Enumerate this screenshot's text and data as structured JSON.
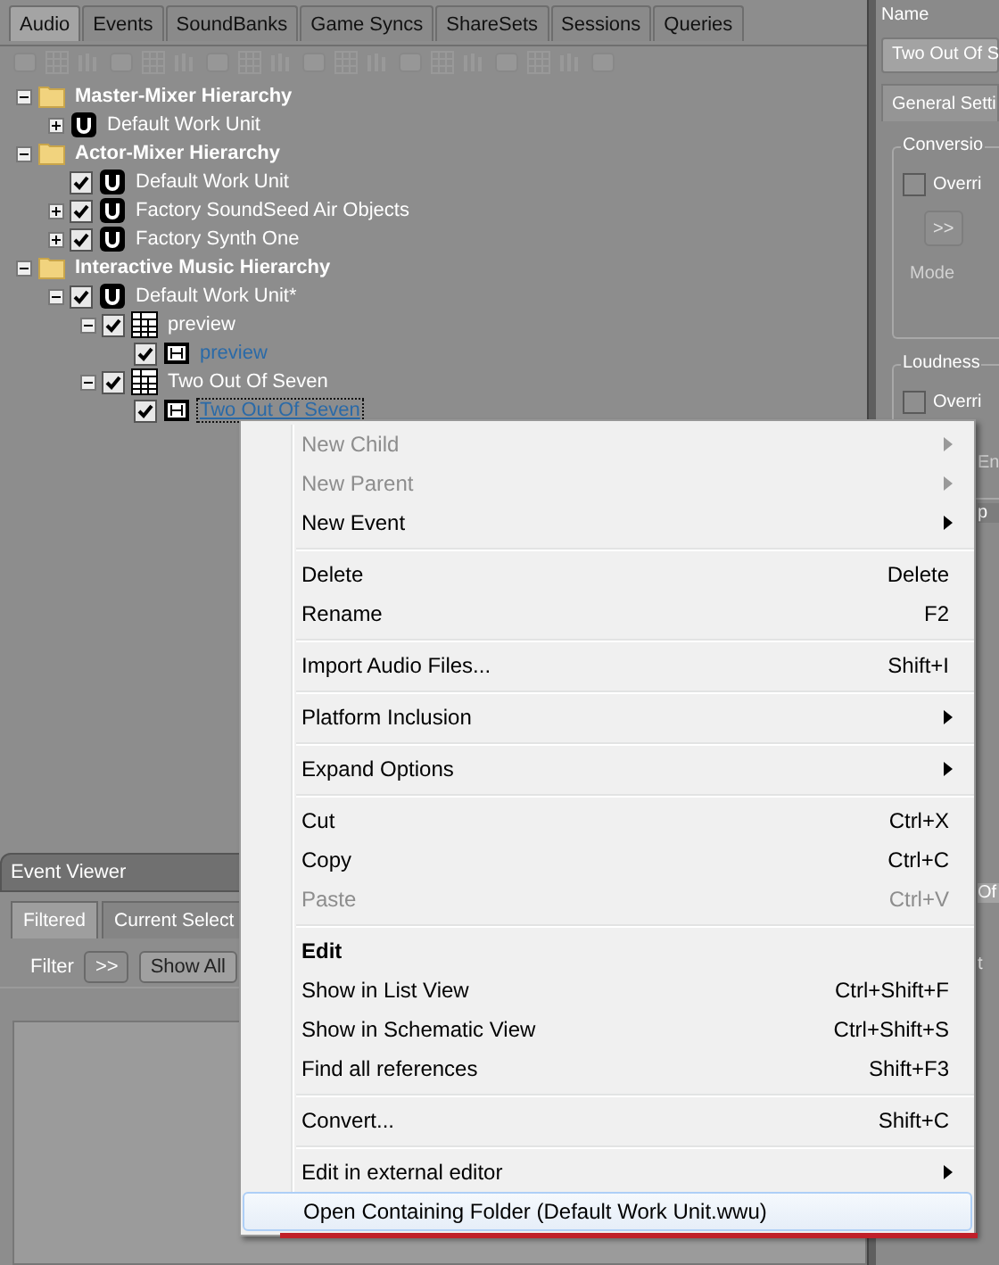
{
  "tabs": [
    {
      "label": "Audio",
      "selected": true
    },
    {
      "label": "Events",
      "selected": false
    },
    {
      "label": "SoundBanks",
      "selected": false
    },
    {
      "label": "Game Syncs",
      "selected": false
    },
    {
      "label": "ShareSets",
      "selected": false
    },
    {
      "label": "Sessions",
      "selected": false
    },
    {
      "label": "Queries",
      "selected": false
    }
  ],
  "tree": [
    {
      "label": "Master-Mixer Hierarchy",
      "kind": "folder",
      "expanded": true,
      "selected": false,
      "children": [
        {
          "label": "Default Work Unit",
          "kind": "workunit",
          "expanded": false,
          "selected": false
        }
      ]
    },
    {
      "label": "Actor-Mixer Hierarchy",
      "kind": "folder",
      "expanded": true,
      "selected": false,
      "children": [
        {
          "label": "Default Work Unit",
          "kind": "workunit",
          "checked": true,
          "selected": false
        },
        {
          "label": "Factory SoundSeed Air Objects",
          "kind": "workunit",
          "expanded": false,
          "checked": true,
          "selected": false
        },
        {
          "label": "Factory Synth One",
          "kind": "workunit",
          "expanded": false,
          "checked": true,
          "selected": false
        }
      ]
    },
    {
      "label": "Interactive Music Hierarchy",
      "kind": "folder",
      "expanded": true,
      "selected": false,
      "children": [
        {
          "label": "Default Work Unit*",
          "kind": "workunit",
          "expanded": true,
          "checked": true,
          "selected": false,
          "children": [
            {
              "label": "preview",
              "kind": "switch",
              "expanded": true,
              "checked": true,
              "selected": false,
              "children": [
                {
                  "label": "preview",
                  "kind": "segment",
                  "checked": true,
                  "selected": false,
                  "linked": true
                }
              ]
            },
            {
              "label": "Two Out Of Seven",
              "kind": "switch",
              "expanded": true,
              "checked": true,
              "selected": false,
              "children": [
                {
                  "label": "Two Out Of Seven",
                  "kind": "segment",
                  "checked": true,
                  "selected": true,
                  "linked": true
                }
              ]
            }
          ]
        }
      ]
    }
  ],
  "event_viewer": {
    "title": "Event Viewer",
    "tabs": [
      {
        "label": "Filtered",
        "selected": true
      },
      {
        "label": "Current Select",
        "selected": false
      }
    ],
    "filter_label": "Filter",
    "filter_button": ">>",
    "show_all_button": "Show All"
  },
  "property_panel": {
    "name_label": "Name",
    "name_value": "Two Out Of S",
    "tab": "General Setti",
    "groups": [
      {
        "title": "Conversio",
        "override_label": "Overri",
        "override_checked": false,
        "button": ">>",
        "mode_label": "Mode"
      },
      {
        "title": "Loudness",
        "override_label": "Overri",
        "override_checked": false
      }
    ],
    "fragments": [
      "En",
      "p",
      "Of",
      "t"
    ]
  },
  "context_menu": [
    {
      "kind": "item",
      "label": "New Child",
      "disabled": true,
      "submenu": true,
      "selected": false
    },
    {
      "kind": "item",
      "label": "New Parent",
      "disabled": true,
      "submenu": true,
      "selected": false
    },
    {
      "kind": "item",
      "label": "New Event",
      "disabled": false,
      "submenu": true,
      "selected": false
    },
    {
      "kind": "separator"
    },
    {
      "kind": "item",
      "label": "Delete",
      "shortcut": "Delete",
      "disabled": false,
      "selected": false
    },
    {
      "kind": "item",
      "label": "Rename",
      "shortcut": "F2",
      "disabled": false,
      "selected": false
    },
    {
      "kind": "separator"
    },
    {
      "kind": "item",
      "label": "Import Audio Files...",
      "shortcut": "Shift+I",
      "disabled": false,
      "selected": false
    },
    {
      "kind": "separator"
    },
    {
      "kind": "item",
      "label": "Platform Inclusion",
      "disabled": false,
      "submenu": true,
      "selected": false
    },
    {
      "kind": "separator"
    },
    {
      "kind": "item",
      "label": "Expand Options",
      "disabled": false,
      "submenu": true,
      "selected": false
    },
    {
      "kind": "separator"
    },
    {
      "kind": "item",
      "label": "Cut",
      "shortcut": "Ctrl+X",
      "disabled": false,
      "selected": false
    },
    {
      "kind": "item",
      "label": "Copy",
      "shortcut": "Ctrl+C",
      "disabled": false,
      "selected": false
    },
    {
      "kind": "item",
      "label": "Paste",
      "shortcut": "Ctrl+V",
      "disabled": true,
      "selected": false
    },
    {
      "kind": "separator"
    },
    {
      "kind": "item",
      "label": "Edit",
      "disabled": false,
      "default": true,
      "selected": false
    },
    {
      "kind": "item",
      "label": "Show in List View",
      "shortcut": "Ctrl+Shift+F",
      "disabled": false,
      "selected": false
    },
    {
      "kind": "item",
      "label": "Show in Schematic View",
      "shortcut": "Ctrl+Shift+S",
      "disabled": false,
      "selected": false
    },
    {
      "kind": "item",
      "label": "Find all references",
      "shortcut": "Shift+F3",
      "disabled": false,
      "selected": false
    },
    {
      "kind": "separator"
    },
    {
      "kind": "item",
      "label": "Convert...",
      "shortcut": "Shift+C",
      "disabled": false,
      "selected": false
    },
    {
      "kind": "separator"
    },
    {
      "kind": "item",
      "label": "Edit in external editor",
      "disabled": false,
      "submenu": true,
      "selected": false
    },
    {
      "kind": "item",
      "label": "Open Containing Folder (Default Work Unit.wwu)",
      "disabled": false,
      "selected": true,
      "underlined": true
    }
  ]
}
